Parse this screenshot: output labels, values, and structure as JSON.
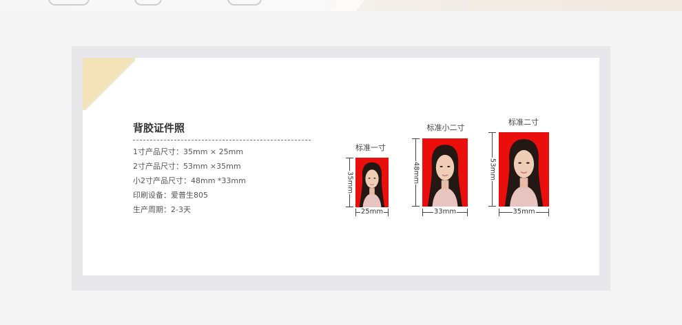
{
  "product": {
    "title": "背胶证件照",
    "specs": [
      "1寸产品尺寸：35mm × 25mm",
      "2寸产品尺寸：53mm ×35mm",
      "小2寸产品尺寸：48mm *33mm",
      "印刷设备：爱普生805",
      "生产周期：2-3天"
    ]
  },
  "photos": [
    {
      "label": "标准一寸",
      "height_label": "35mm",
      "width_label": "25mm",
      "background": "#ea0e0c"
    },
    {
      "label": "标准小二寸",
      "height_label": "48mm",
      "width_label": "33mm",
      "background": "#ea0e0c"
    },
    {
      "label": "标准二寸",
      "height_label": "53mm",
      "width_label": "35mm",
      "background": "#ea0e0c"
    }
  ],
  "colors": {
    "page_background": "#f4f4f4",
    "frame": "#e7e7ec",
    "card": "#ffffff",
    "corner_accent": "#f3e3b8",
    "photo_red": "#ea0e0c"
  }
}
